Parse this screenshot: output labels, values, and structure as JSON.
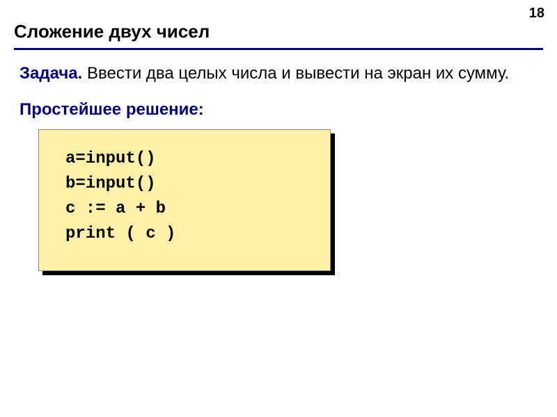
{
  "page_number": "18",
  "title": "Сложение двух чисел",
  "task": {
    "label": "Задача.",
    "text": " Ввести два целых числа и вывести на экран их сумму."
  },
  "solution_label": "Простейшее решение:",
  "code": {
    "line1": "a=input()",
    "line2": "b=input()",
    "line3": "c := a + b",
    "line4": "print ( c )"
  }
}
